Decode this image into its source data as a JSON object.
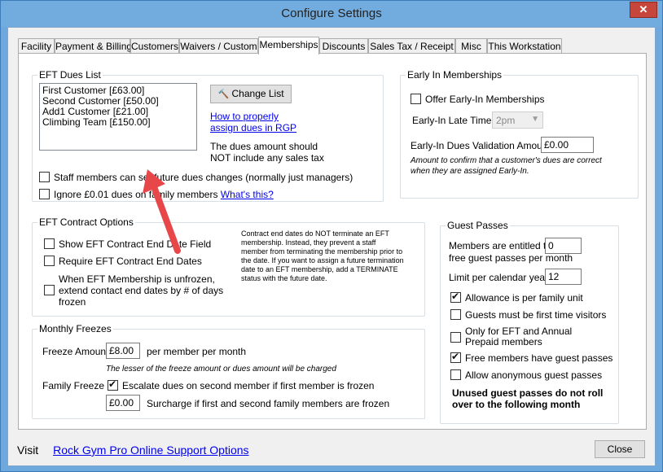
{
  "window": {
    "title": "Configure Settings",
    "close_glyph": "✕"
  },
  "tabs": [
    {
      "label": "Facility"
    },
    {
      "label": "Payment & Billing"
    },
    {
      "label": "Customers"
    },
    {
      "label": "Waivers / Custom"
    },
    {
      "label": "Memberships"
    },
    {
      "label": "Discounts"
    },
    {
      "label": "Sales Tax / Receipt"
    },
    {
      "label": "Misc"
    },
    {
      "label": "This Workstation"
    }
  ],
  "eft_dues": {
    "title": "EFT Dues List",
    "items": [
      "First Customer [£63.00]",
      "Second Customer [£50.00]",
      "Add1 Customer [£21.00]",
      "Climbing Team [£150.00]"
    ],
    "change_list_label": "Change List",
    "help_link_line1": "How to properly",
    "help_link_line2": "assign dues in RGP",
    "note_line1": "The dues amount should",
    "note_line2": "NOT include any sales tax",
    "staff_check_label": "Staff members can set future dues changes (normally just managers)",
    "ignore_check_label": "Ignore £0.01 dues on family members",
    "whats_this": "What's this?"
  },
  "eft_contract": {
    "title": "EFT Contract Options",
    "show_end_date": "Show EFT Contract End Date Field",
    "require_end_dates": "Require EFT Contract End Dates",
    "unfrozen_line1": "When EFT Membership is unfrozen,",
    "unfrozen_line2": "extend contact end dates by # of days",
    "unfrozen_line3": "frozen",
    "note_lines": [
      "Contract end dates do NOT terminate an EFT",
      "membership.  Instead, they prevent a staff",
      "member from terminating the membership prior to",
      "the date.  If you want to assign a future termination",
      "date to an EFT membership, add a TERMINATE",
      "status with the future date."
    ]
  },
  "monthly_freezes": {
    "title": "Monthly Freezes",
    "freeze_amount_label": "Freeze Amount",
    "freeze_amount_value": "£8.00",
    "per_member_label": "per member per month",
    "lesser_note": "The lesser of the freeze amount or dues amount will be charged",
    "family_freeze_label": "Family Freeze",
    "escalate_label": "Escalate dues on second member if first member is frozen",
    "surcharge_value": "£0.00",
    "surcharge_label": "Surcharge if first and second family members are frozen"
  },
  "early_in": {
    "title": "Early In Memberships",
    "offer_label": "Offer Early-In Memberships",
    "late_time_label": "Early-In Late Time",
    "late_time_value": "2pm",
    "validation_label": "Early-In Dues Validation Amount",
    "validation_value": "£0.00",
    "note_line1": "Amount to confirm that a customer's dues are correct",
    "note_line2": "when they are assigned Early-In."
  },
  "guest_passes": {
    "title": "Guest Passes",
    "entitled_line1": "Members are entitled to",
    "entitled_line2": "free guest passes per month",
    "entitled_value": "0",
    "limit_label": "Limit per calendar year",
    "limit_value": "12",
    "allowance_label": "Allowance is per family unit",
    "first_time_label": "Guests must be first time visitors",
    "only_eft_line1": "Only for EFT and Annual",
    "only_eft_line2": "Prepaid members",
    "free_members_label": "Free members have guest passes",
    "anonymous_label": "Allow anonymous guest passes",
    "unused_line1": "Unused guest passes do not roll",
    "unused_line2": "over to the following month"
  },
  "footer": {
    "visit_label": "Visit",
    "support_link": "Rock Gym Pro Online Support Options",
    "close_label": "Close"
  },
  "colors": {
    "annotation_arrow": "#e8474a",
    "link": "#0000ee"
  }
}
